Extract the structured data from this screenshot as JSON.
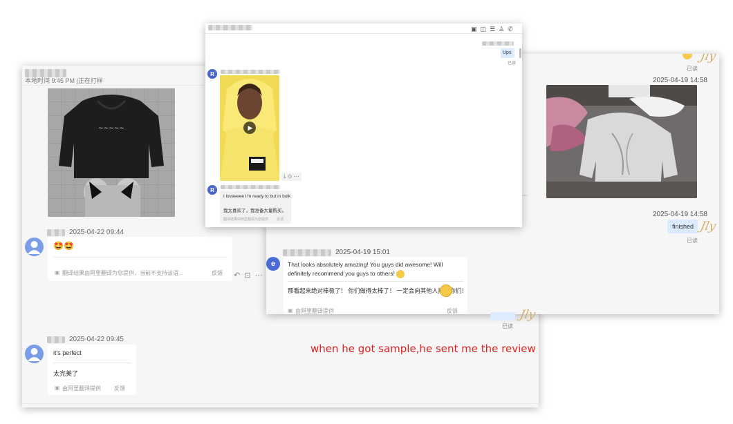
{
  "left_panel": {
    "header_status": "本地时间  9:45 PM  |正在打样",
    "msg1": {
      "date": "2025-04-22 09:44",
      "emoji": "🤩🤩",
      "translation_note": "翻译结果由阿里翻译为您提供，当前不支持该语...",
      "feedback": "反馈"
    },
    "msg2": {
      "date": "2025-04-22 09:45",
      "text": "it's perfect",
      "translation": "太完美了",
      "translation_note": "由阿里翻译提供",
      "feedback": "反馈"
    },
    "avatar_letter": ""
  },
  "top_panel": {
    "reply_text": "Ups",
    "read_label": "已读",
    "avatar_letter": "R",
    "msg_text": "I loveeeee I'm ready to but in bulk",
    "msg_translation": "我太喜欢了，我准备大量购买。",
    "translation_note": "翻译结果由阿里翻译为您提供",
    "feedback": "反馈"
  },
  "right_panel": {
    "read_top": "已读",
    "date1": "2025-04-19 14:58",
    "date2": "2025-04-19 14:58",
    "finished": "finished",
    "read2": "已读",
    "read3": "已读",
    "read4": "已读",
    "avatar_letter": "e",
    "msg_date": "2025-04-19 15:01",
    "msg_text": "That looks absolutely amazing! You guys did awesome! Will definitely recommend you guys to others!",
    "msg_translation": "那看起来绝对棒极了！ 你们做得太棒了！ 一定会向其他人推荐你们！",
    "translation_note": "由阿里翻译提供",
    "feedback": "反馈"
  },
  "annotation": "when he got sample,he sent me the review",
  "colors": {
    "annotation": "#e02020",
    "avatar_left": "#7b9de8",
    "avatar_r": "#4867c9",
    "avatar_e": "#4a6bd6",
    "reply_bubble": "#dcebff"
  }
}
